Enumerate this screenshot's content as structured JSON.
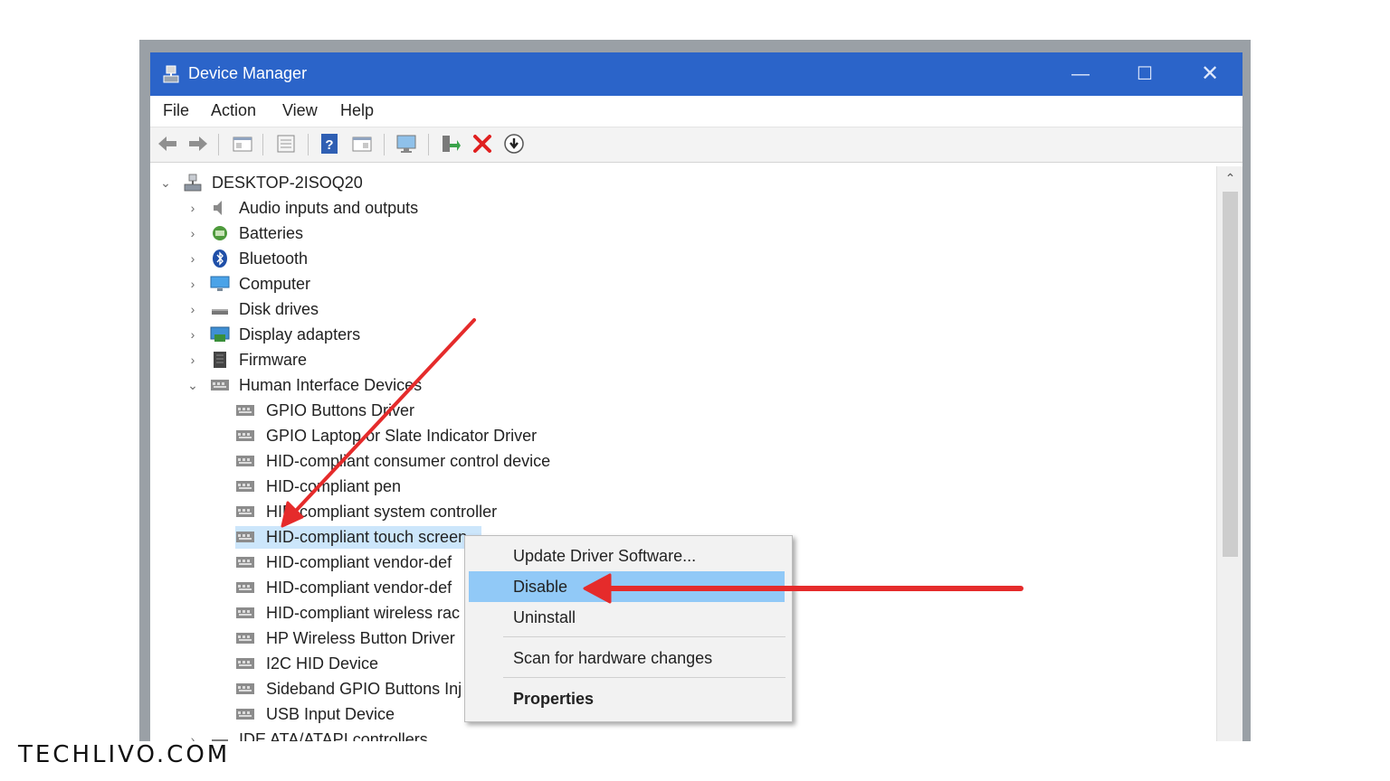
{
  "window": {
    "title": "Device Manager",
    "controls": {
      "minimize": "—",
      "maximize": "☐",
      "close": "✕"
    }
  },
  "menu": {
    "items": [
      "File",
      "Action",
      "View",
      "Help"
    ]
  },
  "toolbar": {
    "icons": [
      "back-icon",
      "forward-icon",
      "properties-pane-icon",
      "device-list-icon",
      "help-icon",
      "details-icon",
      "scan-monitor-icon",
      "update-driver-icon",
      "uninstall-icon",
      "download-driver-icon"
    ],
    "accent": "#e02020"
  },
  "tree": {
    "root": "DESKTOP-2ISOQ20",
    "categories": [
      "Audio inputs and outputs",
      "Batteries",
      "Bluetooth",
      "Computer",
      "Disk drives",
      "Display adapters",
      "Firmware"
    ],
    "hid": {
      "label": "Human Interface Devices",
      "children": [
        "GPIO Buttons Driver",
        "GPIO Laptop or Slate Indicator Driver",
        "HID-compliant consumer control device",
        "HID-compliant pen",
        "HID-compliant system controller",
        "HID-compliant touch screen",
        "HID-compliant vendor-def",
        "HID-compliant vendor-def",
        "HID-compliant wireless rac",
        "HP Wireless Button Driver",
        "I2C HID Device",
        "Sideband GPIO Buttons Inj",
        "USB Input Device"
      ],
      "selected": "HID-compliant touch screen"
    },
    "next_category": "IDE ATA/ATAPI controllers"
  },
  "context_menu": {
    "update": "Update Driver Software...",
    "disable": "Disable",
    "uninstall": "Uninstall",
    "scan": "Scan for hardware changes",
    "properties": "Properties"
  },
  "colors": {
    "titlebar": "#2b64c9",
    "selection": "#cce6fb",
    "menu_highlight": "#91c9f7",
    "annotation": "#e52b2b"
  },
  "watermark": "TECHLIVO.COM"
}
